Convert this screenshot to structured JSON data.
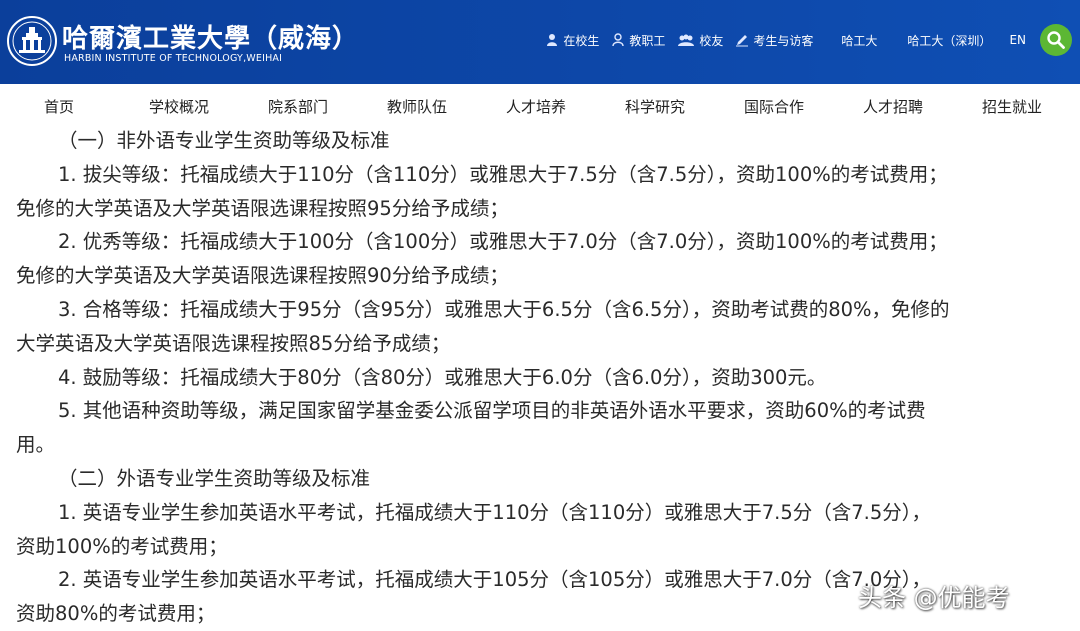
{
  "header": {
    "school_name_cn": "哈爾濱工業大學（威海）",
    "school_name_en": "HARBIN INSTITUTE OF TECHNOLOGY,WEIHAI",
    "links": {
      "students": "在校生",
      "staff": "教职工",
      "alumni": "校友",
      "visitors": "考生与访客",
      "hit": "哈工大",
      "hit_shenzhen": "哈工大（深圳）",
      "english": "EN"
    },
    "colors": {
      "background": "#0d47a8",
      "search": "#5cb734"
    }
  },
  "nav": {
    "items": [
      "首页",
      "学校概况",
      "院系部门",
      "教师队伍",
      "人才培养",
      "科学研究",
      "国际合作",
      "人才招聘",
      "招生就业"
    ]
  },
  "content": {
    "lines": [
      "（一）非外语专业学生资助等级及标准",
      "1. 拔尖等级：托福成绩大于110分（含110分）或雅思大于7.5分（含7.5分），资助100%的考试费用；",
      "免修的大学英语及大学英语限选课程按照95分给予成绩；",
      "2. 优秀等级：托福成绩大于100分（含100分）或雅思大于7.0分（含7.0分），资助100%的考试费用；",
      "免修的大学英语及大学英语限选课程按照90分给予成绩；",
      "3. 合格等级：托福成绩大于95分（含95分）或雅思大于6.5分（含6.5分），资助考试费的80%，免修的",
      "大学英语及大学英语限选课程按照85分给予成绩；",
      "4. 鼓励等级：托福成绩大于80分（含80分）或雅思大于6.0分（含6.0分），资助300元。",
      "5. 其他语种资助等级，满足国家留学基金委公派留学项目的非英语外语水平要求，资助60%的考试费",
      "用。",
      "（二）外语专业学生资助等级及标准",
      "1. 英语专业学生参加英语水平考试，托福成绩大于110分（含110分）或雅思大于7.5分（含7.5分），",
      "资助100%的考试费用；",
      "2. 英语专业学生参加英语水平考试，托福成绩大于105分（含105分）或雅思大于7.0分（含7.0分），",
      "资助80%的考试费用；"
    ]
  },
  "watermark": "头条 @优能考"
}
